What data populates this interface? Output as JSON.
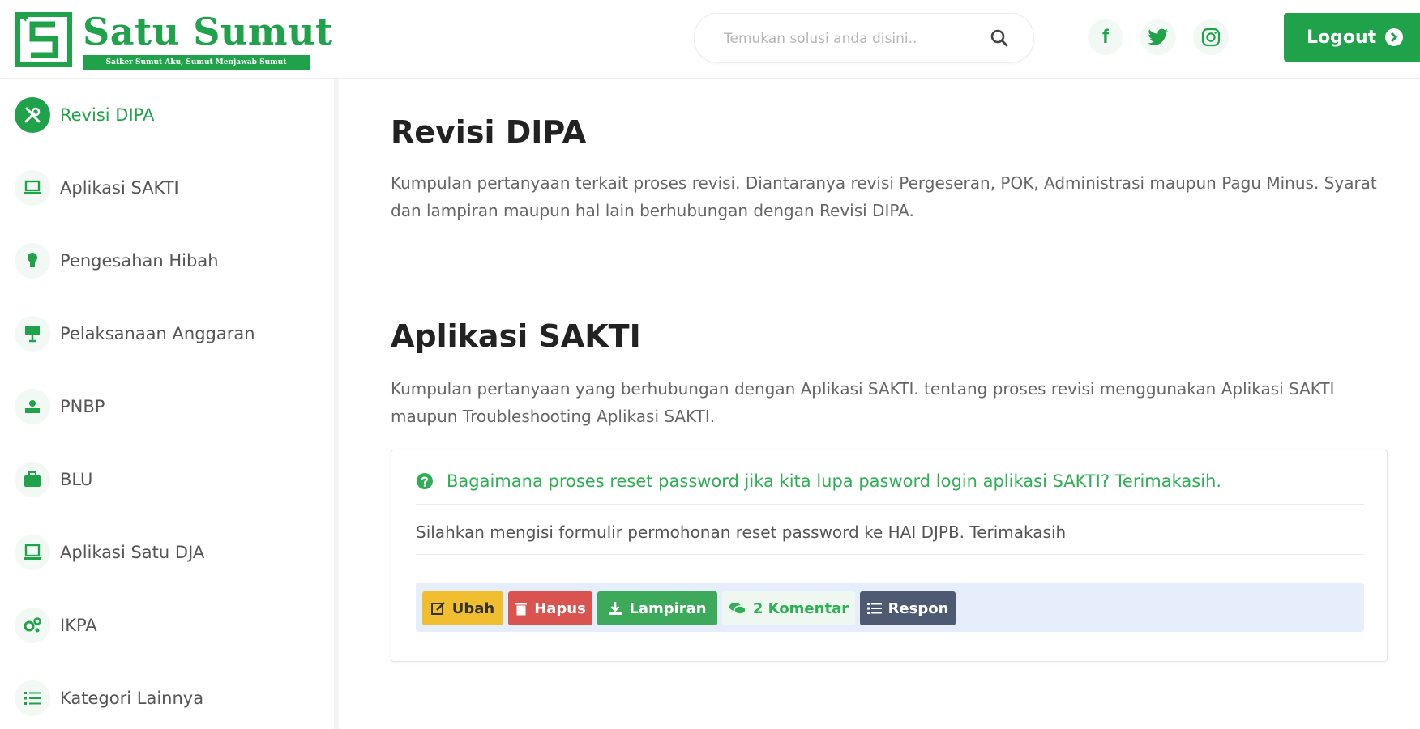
{
  "brand": {
    "title": "Satu Sumut",
    "tagline": "Satker Sumut Aku, Sumut Menjawab Sumut",
    "accent": "#1fa24a"
  },
  "search": {
    "placeholder": "Temukan solusi anda disini..",
    "icon": "search-icon"
  },
  "social": [
    {
      "name": "facebook",
      "glyph": "f"
    },
    {
      "name": "twitter",
      "icon": "twitter-icon"
    },
    {
      "name": "instagram",
      "icon": "instagram-icon"
    }
  ],
  "logout": {
    "label": "Logout"
  },
  "sidebar": {
    "items": [
      {
        "label": "Revisi DIPA",
        "icon": "tools-icon",
        "active": true
      },
      {
        "label": "Aplikasi SAKTI",
        "icon": "laptop-icon"
      },
      {
        "label": "Pengesahan Hibah",
        "icon": "lightbulb-icon"
      },
      {
        "label": "Pelaksanaan Anggaran",
        "icon": "presentation-icon"
      },
      {
        "label": "PNBP",
        "icon": "hands-coin-icon"
      },
      {
        "label": "BLU",
        "icon": "briefcase-icon"
      },
      {
        "label": "Aplikasi Satu DJA",
        "icon": "monitor-icon"
      },
      {
        "label": "IKPA",
        "icon": "gears-icon"
      },
      {
        "label": "Kategori Lainnya",
        "icon": "list-icon"
      }
    ]
  },
  "sections": [
    {
      "title": "Revisi DIPA",
      "description": "Kumpulan pertanyaan terkait proses revisi. Diantaranya revisi Pergeseran, POK, Administrasi maupun Pagu Minus. Syarat dan lampiran maupun hal lain berhubungan dengan Revisi DIPA."
    },
    {
      "title": "Aplikasi SAKTI",
      "description": "Kumpulan pertanyaan yang berhubungan dengan Aplikasi SAKTI. tentang proses revisi menggunakan Aplikasi SAKTI maupun Troubleshooting Aplikasi SAKTI."
    }
  ],
  "faq": {
    "question": "Bagaimana proses reset password jika kita lupa pasword login aplikasi SAKTI? Terimakasih.",
    "answer": "Silahkan mengisi formulir permohonan reset password ke HAI DJPB. Terimakasih",
    "actions": {
      "edit": "Ubah",
      "delete": "Hapus",
      "attachment": "Lampiran",
      "comments": "2 Komentar",
      "respond": "Respon"
    }
  }
}
